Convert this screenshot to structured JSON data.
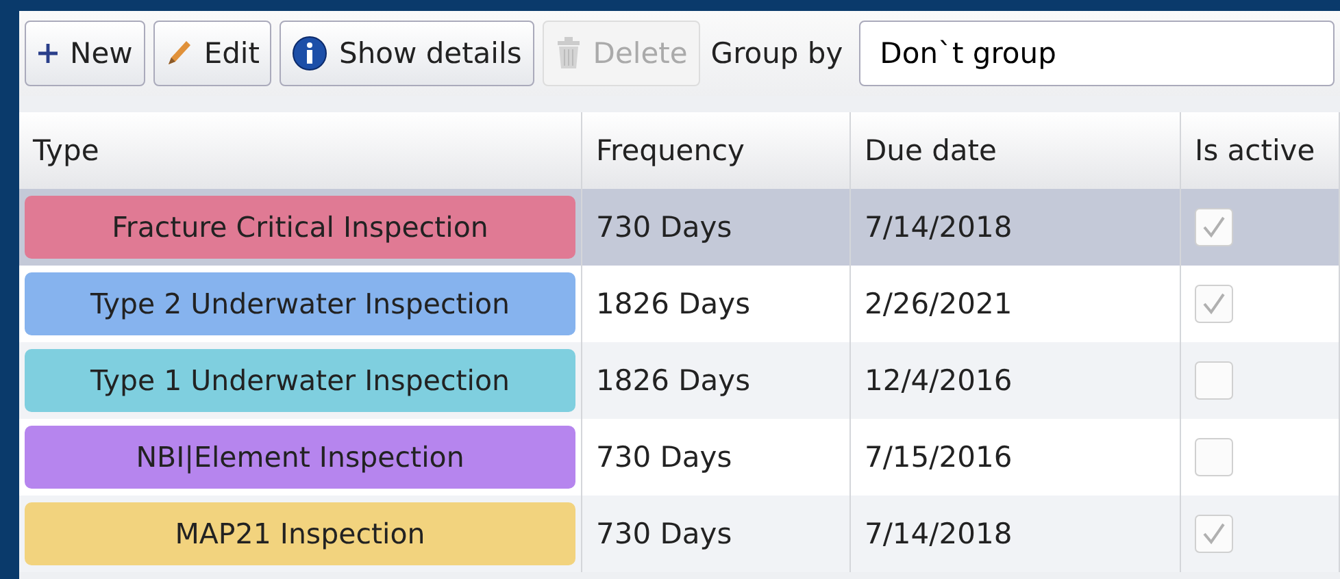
{
  "toolbar": {
    "buttons": [
      {
        "kind": "new",
        "label": "New",
        "disabled": false
      },
      {
        "kind": "edit",
        "label": "Edit",
        "disabled": false
      },
      {
        "kind": "details",
        "label": "Show details",
        "disabled": false
      },
      {
        "kind": "delete",
        "label": "Delete",
        "disabled": true
      }
    ],
    "group_by": {
      "label": "Group by",
      "value": "Don`t group"
    }
  },
  "table": {
    "columns": [
      "Type",
      "Frequency",
      "Due date",
      "Is active"
    ],
    "rows": [
      {
        "type": "Fracture Critical Inspection",
        "color": "#e07a94",
        "frequency": "730 Days",
        "due_date": "7/14/2018",
        "is_active": true,
        "selected": true
      },
      {
        "type": "Type 2 Underwater Inspection",
        "color": "#86b3ee",
        "frequency": "1826 Days",
        "due_date": "2/26/2021",
        "is_active": true,
        "selected": false
      },
      {
        "type": "Type 1 Underwater Inspection",
        "color": "#7fcfdf",
        "frequency": "1826 Days",
        "due_date": "12/4/2016",
        "is_active": false,
        "selected": false
      },
      {
        "type": "NBI|Element Inspection",
        "color": "#b685ee",
        "frequency": "730 Days",
        "due_date": "7/15/2016",
        "is_active": false,
        "selected": false
      },
      {
        "type": "MAP21 Inspection",
        "color": "#f2d37e",
        "frequency": "730 Days",
        "due_date": "7/14/2018",
        "is_active": true,
        "selected": false
      }
    ]
  }
}
